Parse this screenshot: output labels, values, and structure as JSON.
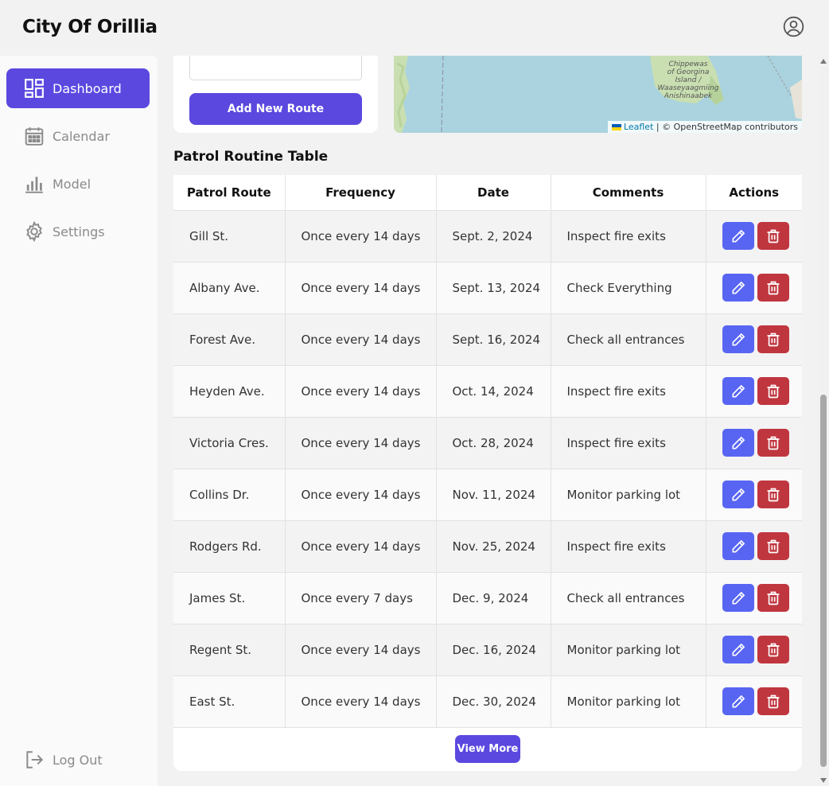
{
  "header": {
    "title": "City Of Orillia",
    "profile_icon": "user-circle-icon"
  },
  "sidebar": {
    "items": [
      {
        "label": "Dashboard",
        "icon": "dashboard-icon",
        "active": true
      },
      {
        "label": "Calendar",
        "icon": "calendar-icon",
        "active": false
      },
      {
        "label": "Model",
        "icon": "bar-chart-icon",
        "active": false
      },
      {
        "label": "Settings",
        "icon": "gear-icon",
        "active": false
      }
    ],
    "logout_label": "Log Out"
  },
  "route_form": {
    "add_button_label": "Add New Route"
  },
  "map": {
    "label_lines": [
      "Chippewas",
      "of Georgina",
      "Island /",
      "Waaseyaagmiing",
      "Anishinaabek"
    ],
    "attribution_leaflet": "Leaflet",
    "attribution_rest": "| © OpenStreetMap contributors"
  },
  "table": {
    "title": "Patrol Routine Table",
    "columns": [
      "Patrol Route",
      "Frequency",
      "Date",
      "Comments",
      "Actions"
    ],
    "rows": [
      {
        "route": "Gill St.",
        "frequency": "Once every 14 days",
        "date": "Sept. 2, 2024",
        "comments": "Inspect fire exits"
      },
      {
        "route": "Albany Ave.",
        "frequency": "Once every 14 days",
        "date": "Sept. 13, 2024",
        "comments": "Check Everything"
      },
      {
        "route": "Forest Ave.",
        "frequency": "Once every 14 days",
        "date": "Sept. 16, 2024",
        "comments": "Check all entrances"
      },
      {
        "route": "Heyden Ave.",
        "frequency": "Once every 14 days",
        "date": "Oct. 14, 2024",
        "comments": "Inspect fire exits"
      },
      {
        "route": "Victoria Cres.",
        "frequency": "Once every 14 days",
        "date": "Oct. 28, 2024",
        "comments": "Inspect fire exits"
      },
      {
        "route": "Collins Dr.",
        "frequency": "Once every 14 days",
        "date": "Nov. 11, 2024",
        "comments": "Monitor parking lot"
      },
      {
        "route": "Rodgers Rd.",
        "frequency": "Once every 14 days",
        "date": "Nov. 25, 2024",
        "comments": "Inspect fire exits"
      },
      {
        "route": "James St.",
        "frequency": "Once every 7 days",
        "date": "Dec. 9, 2024",
        "comments": "Check all entrances"
      },
      {
        "route": "Regent St.",
        "frequency": "Once every 14 days",
        "date": "Dec. 16, 2024",
        "comments": "Monitor parking lot"
      },
      {
        "route": "East St.",
        "frequency": "Once every 14 days",
        "date": "Dec. 30, 2024",
        "comments": "Monitor parking lot"
      }
    ],
    "view_more_label": "View More"
  },
  "colors": {
    "accent": "#5a48df",
    "edit": "#5865f2",
    "delete": "#c0363f"
  }
}
